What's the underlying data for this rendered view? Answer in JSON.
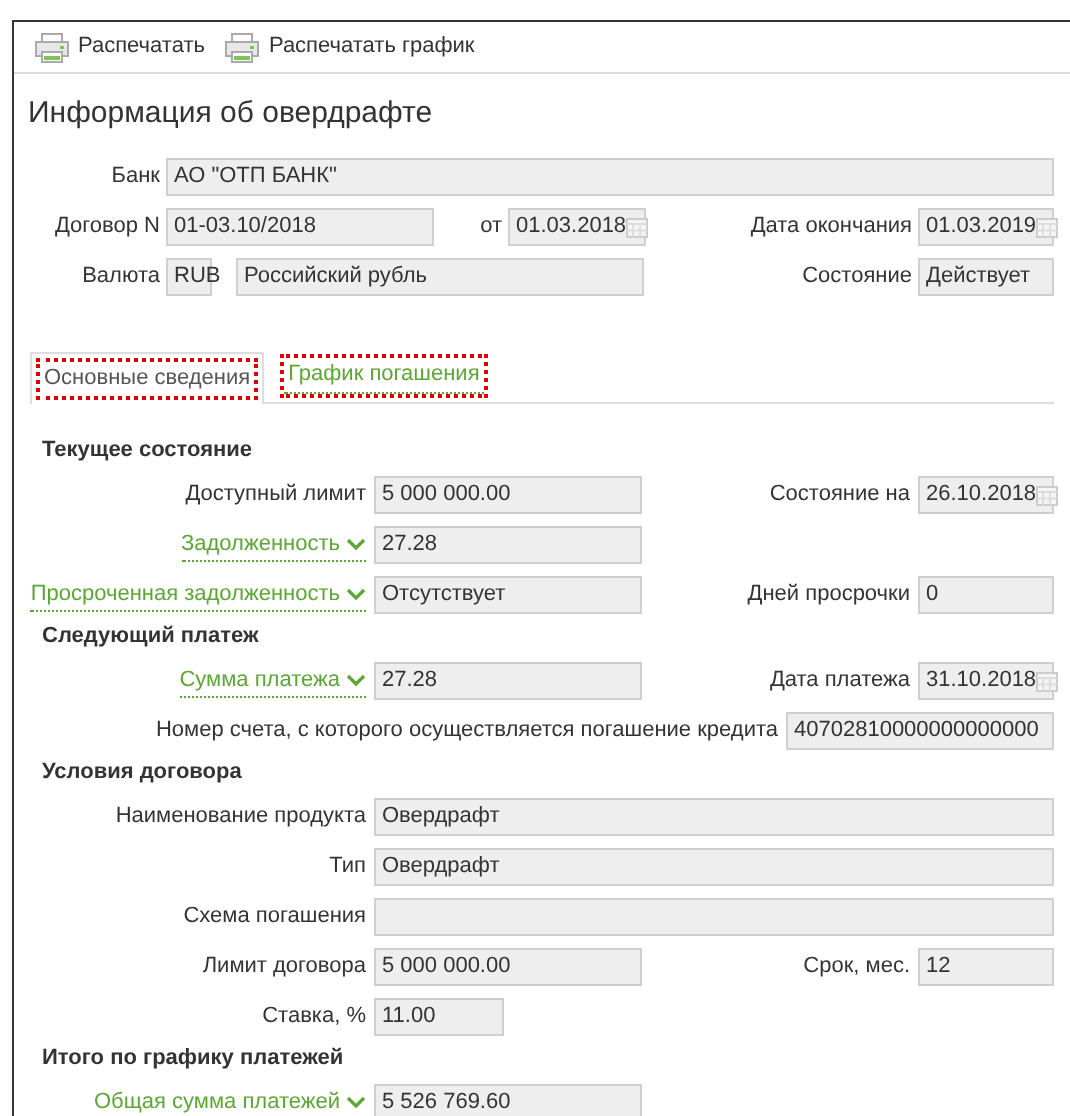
{
  "toolbar": [
    {
      "label": "Распечатать"
    },
    {
      "label": "Распечатать график"
    }
  ],
  "title": "Информация об овердрафте",
  "header": {
    "bank": {
      "label": "Банк",
      "value": "АО \"ОТП БАНК\""
    },
    "contract": {
      "label": "Договор N",
      "value": "01-03.10/2018"
    },
    "contract_date": {
      "label": "от",
      "value": "01.03.2018"
    },
    "end_date": {
      "label": "Дата окончания",
      "value": "01.03.2019"
    },
    "currency": {
      "label": "Валюта",
      "code": "RUB",
      "name": "Российский рубль"
    },
    "status": {
      "label": "Состояние",
      "value": "Действует"
    }
  },
  "tabs": [
    {
      "label": "Основные сведения",
      "selected": true,
      "highlighted": true
    },
    {
      "label": "График погашения",
      "selected": false,
      "highlighted": true
    }
  ],
  "sections": [
    {
      "heading": "Текущее состояние",
      "rows": [
        {
          "left": {
            "label": "Доступный лимит",
            "value": "5 000 000.00",
            "dropdown": false
          },
          "right": {
            "label": "Состояние на",
            "value": "26.10.2018",
            "date": true
          }
        },
        {
          "left": {
            "label": "Задолженность",
            "value": "27.28",
            "dropdown": true
          }
        },
        {
          "left": {
            "label": "Просроченная задолженность",
            "value": "Отсутствует",
            "dropdown": true
          },
          "right": {
            "label": "Дней просрочки",
            "value": "0",
            "date": false
          }
        }
      ]
    },
    {
      "heading": "Следующий платеж",
      "rows": [
        {
          "left": {
            "label": "Сумма платежа",
            "value": "27.28",
            "dropdown": true
          },
          "right": {
            "label": "Дата платежа",
            "value": "31.10.2018",
            "date": true
          }
        },
        {
          "left": {
            "label": "Номер счета, с которого осуществляется погашение кредита",
            "value": "40702810000000000000",
            "dropdown": false
          }
        }
      ]
    },
    {
      "heading": "Условия договора",
      "rows": [
        {
          "left": {
            "label": "Наименование продукта",
            "value": "Овердрафт",
            "dropdown": false
          }
        },
        {
          "left": {
            "label": "Тип",
            "value": "Овердрафт",
            "dropdown": false
          }
        },
        {
          "left": {
            "label": "Схема погашения",
            "dropdown": false
          }
        },
        {
          "left": {
            "label": "Лимит договора",
            "value": "5 000 000.00",
            "dropdown": false
          },
          "right": {
            "label": "Срок, мес.",
            "value": "12",
            "date": false
          }
        },
        {
          "left": {
            "label": "Ставка, %",
            "value": "11.00",
            "dropdown": false
          }
        }
      ]
    },
    {
      "heading": "Итого по графику платежей",
      "rows": [
        {
          "left": {
            "label": "Общая сумма платежей",
            "value": "5 526 769.60",
            "dropdown": true
          }
        }
      ]
    }
  ]
}
